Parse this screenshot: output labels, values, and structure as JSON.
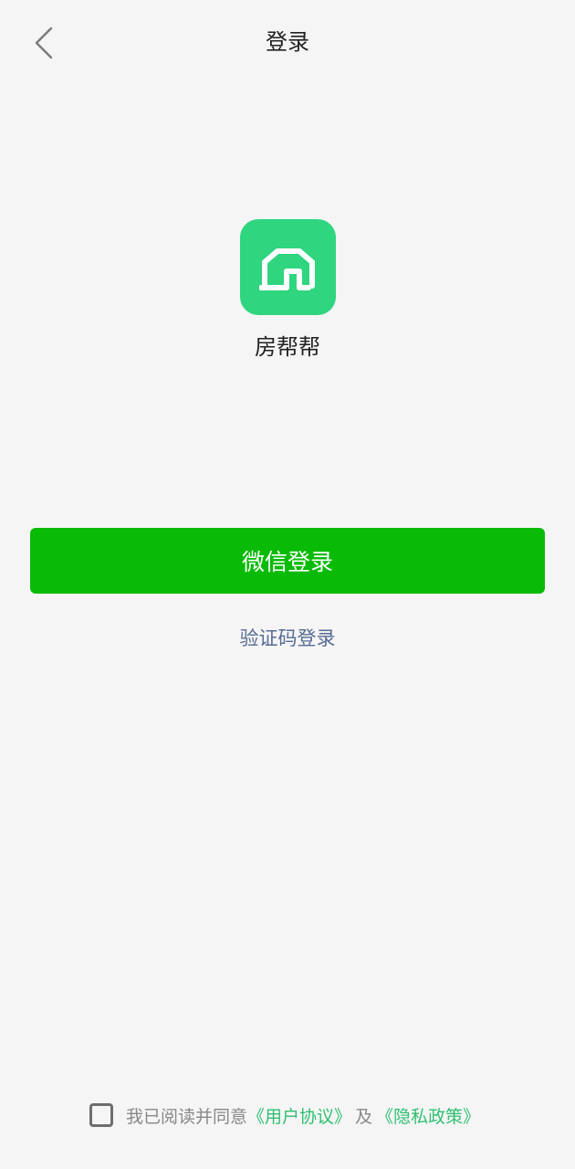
{
  "header": {
    "title": "登录",
    "back_icon": "chevron-left-icon"
  },
  "app": {
    "name": "房帮帮",
    "logo_icon": "house-icon"
  },
  "actions": {
    "wechat_login_label": "微信登录",
    "code_login_label": "验证码登录"
  },
  "agreement": {
    "checked": false,
    "prefix": "我已阅读并同意",
    "user_agreement": "《用户协议》",
    "and": "及",
    "privacy_policy": "《隐私政策》"
  },
  "colors": {
    "background": "#f5f5f5",
    "brand": "#2fd57f",
    "wechat": "#09bb07",
    "link_blue": "#576b95",
    "link_green": "#2fbf71"
  }
}
